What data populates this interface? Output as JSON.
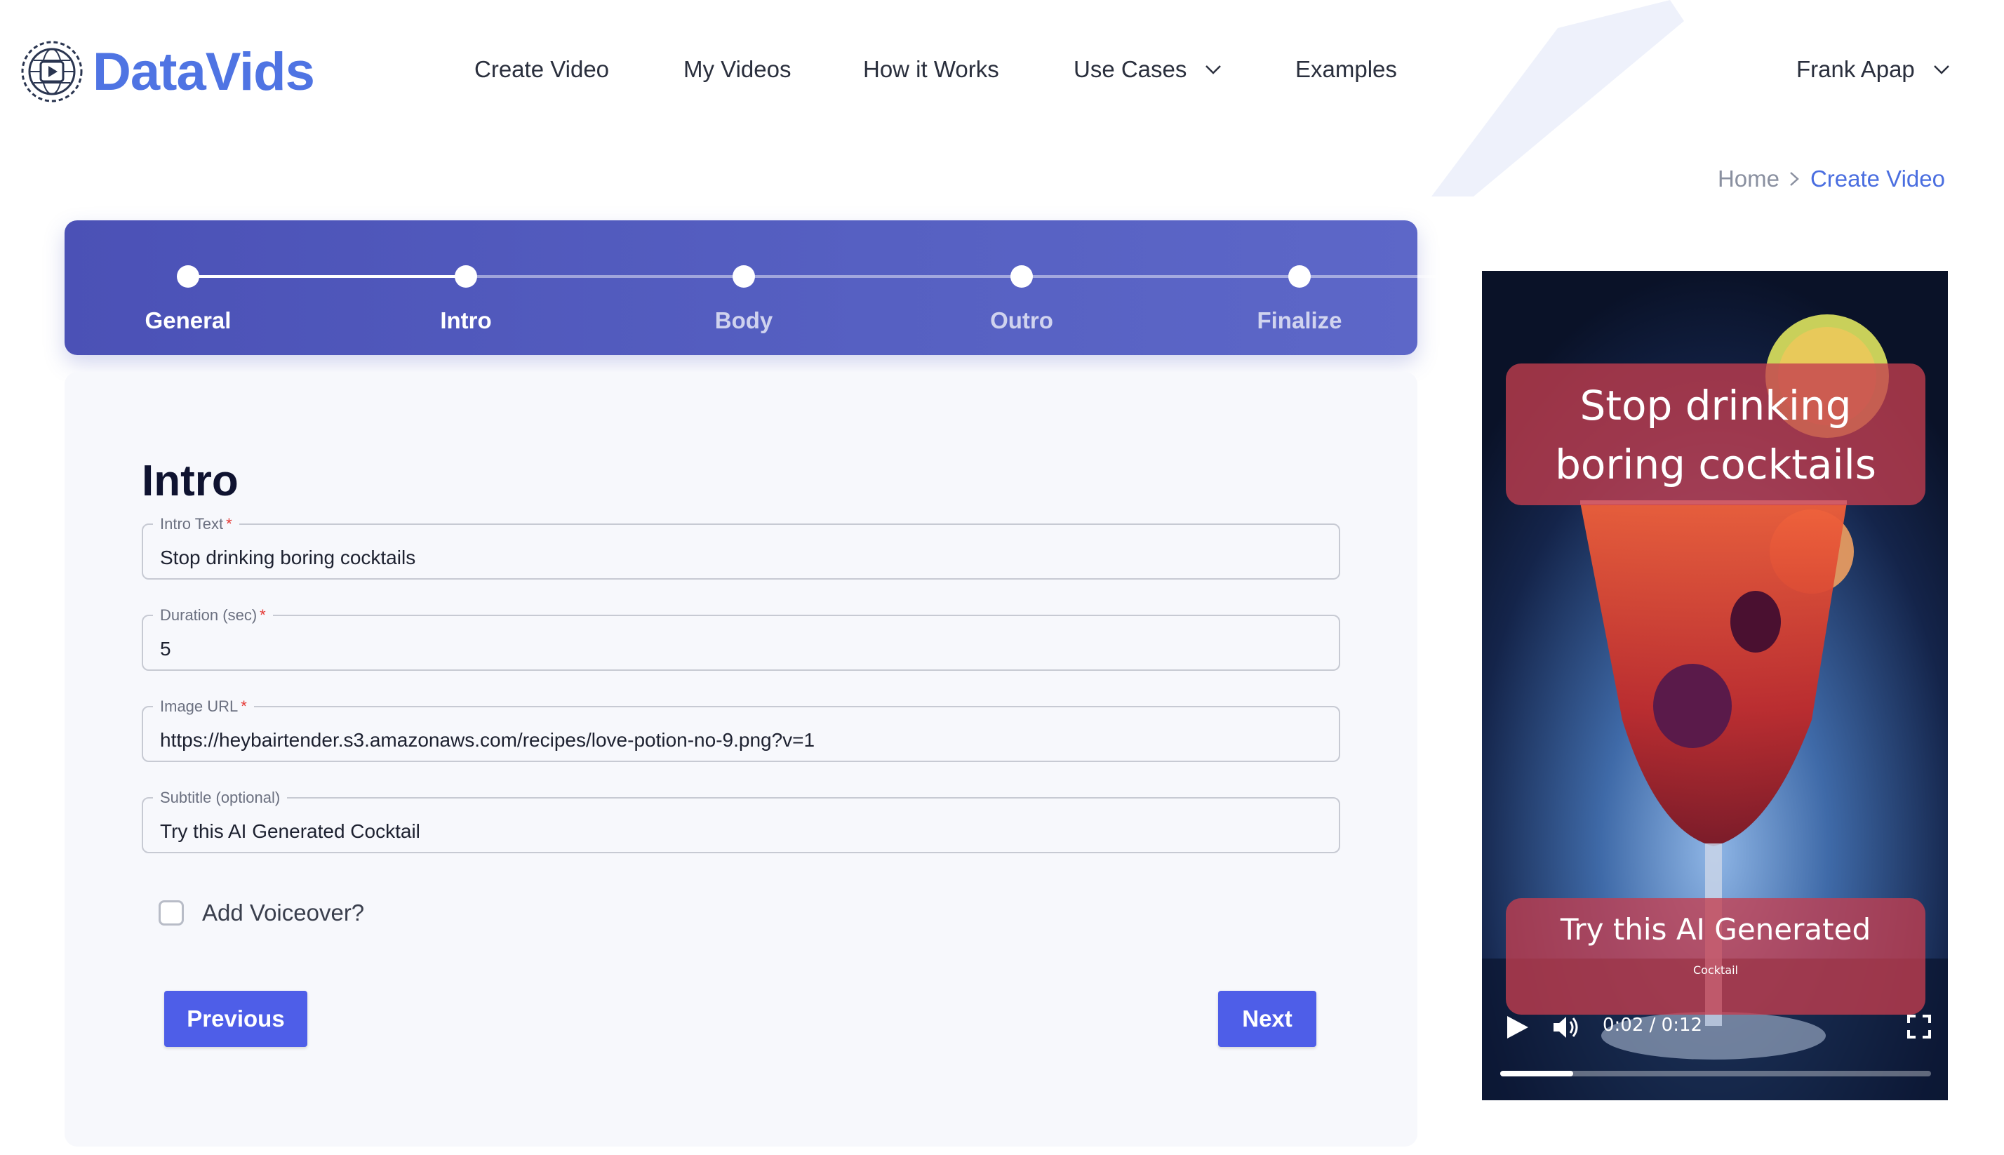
{
  "brand": {
    "name": "DataVids",
    "accent": "#4f74e3"
  },
  "nav": {
    "items": [
      {
        "label": "Create Video"
      },
      {
        "label": "My Videos"
      },
      {
        "label": "How it Works"
      },
      {
        "label": "Use Cases",
        "has_dropdown": true
      },
      {
        "label": "Examples"
      }
    ],
    "user": {
      "name": "Frank Apap",
      "icon": "chevron-down-icon"
    }
  },
  "breadcrumb": {
    "home": "Home",
    "current": "Create Video"
  },
  "stepper": {
    "active_index": 1,
    "steps": [
      "General",
      "Intro",
      "Body",
      "Outro",
      "Finalize"
    ],
    "color": "#4b51b6"
  },
  "form": {
    "title": "Intro",
    "fields": [
      {
        "label": "Intro Text",
        "required": "*",
        "value": "Stop drinking boring cocktails"
      },
      {
        "label": "Duration (sec)",
        "required": "*",
        "value": "5"
      },
      {
        "label": "Image URL",
        "required": "*",
        "value": "https://heybairtender.s3.amazonaws.com/recipes/love-potion-no-9.png?v=1"
      },
      {
        "label": "Subtitle (optional)",
        "value": "Try this AI Generated Cocktail"
      }
    ],
    "voiceover": {
      "label": "Add Voiceover?",
      "checked": false
    },
    "previous_label": "Previous",
    "next_label": "Next",
    "button_color": "#4e5ee8"
  },
  "preview": {
    "caption_top_line1": "Stop drinking",
    "caption_top_line2": "boring cocktails",
    "caption_bottom": "Try this AI  Generated",
    "caption_bottom_small": "Cocktail",
    "time": "0:02 / 0:12",
    "progress_fraction": 0.17,
    "caption_color": "#c43e4e"
  }
}
